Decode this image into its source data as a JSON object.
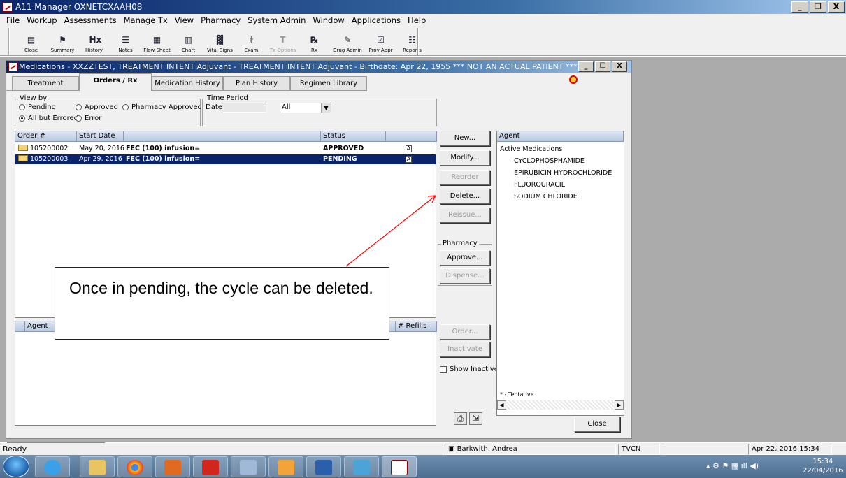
{
  "app": {
    "title": "A11 Manager OXNETCXAAH08",
    "window_buttons": [
      "_",
      "ȡ",
      "X"
    ]
  },
  "menu": [
    "File",
    "Workup",
    "Assessments",
    "Manage Tx",
    "View",
    "Pharmacy",
    "System Admin",
    "Window",
    "Applications",
    "Help"
  ],
  "toolbar": [
    {
      "label": "Close",
      "icon": "folder-icon",
      "glyph": "▤"
    },
    {
      "label": "Summary",
      "icon": "flag-icon",
      "glyph": "⚑"
    },
    {
      "label": "History",
      "icon": "hx-icon",
      "glyph": "Hx"
    },
    {
      "label": "Notes",
      "icon": "notes-icon",
      "glyph": "☰"
    },
    {
      "label": "Flow Sheet",
      "icon": "grid-icon",
      "glyph": "▦"
    },
    {
      "label": "Chart",
      "icon": "chart-icon",
      "glyph": "▥"
    },
    {
      "label": "Vital Signs",
      "icon": "vitals-icon",
      "glyph": "▓"
    },
    {
      "label": "Exam",
      "icon": "stethoscope-icon",
      "glyph": "⚕"
    },
    {
      "label": "Tx Options",
      "icon": "tx-options-icon",
      "glyph": "T",
      "disabled": true
    },
    {
      "label": "Rx",
      "icon": "rx-icon",
      "glyph": "℞"
    },
    {
      "label": "Drug Admin",
      "icon": "drug-admin-icon",
      "glyph": "✎"
    },
    {
      "label": "Prov Appr",
      "icon": "prov-appr-icon",
      "glyph": "☑"
    },
    {
      "label": "Reports",
      "icon": "reports-icon",
      "glyph": "☷"
    }
  ],
  "child": {
    "title": "Medications - XXZZTEST, TREATMENT INTENT Adjuvant  - TREATMENT INTENT Adjuvant - Birthdate: Apr 22, 1955 *** NOT AN ACTUAL PATIENT ***",
    "tabs": [
      "Treatment",
      "Orders / Rx",
      "Medication History",
      "Plan History",
      "Regimen Library"
    ],
    "active_tab": "Orders / Rx",
    "view_by": {
      "label": "View by",
      "options": [
        "Pending",
        "Approved",
        "Pharmacy Approved",
        "All but Errored",
        "Error"
      ],
      "selected": "All but Errored"
    },
    "time_period": {
      "label": "Time Period",
      "date_label": "Date",
      "date_value": "",
      "range_value": "All"
    },
    "orders": {
      "headers": [
        "Order #",
        "Start Date",
        "",
        "Status",
        ""
      ],
      "rows": [
        {
          "order": "105200002",
          "start": "May 20, 2016",
          "desc": "FEC (100) infusion=",
          "status": "APPROVED",
          "badge": "A",
          "selected": false
        },
        {
          "order": "105200003",
          "start": "Apr 29, 2016",
          "desc": "FEC (100) infusion=",
          "status": "PENDING",
          "badge": "A",
          "selected": true
        }
      ]
    },
    "buttons": {
      "new": "New...",
      "modify": "Modify...",
      "reorder": "Reorder",
      "delete": "Delete...",
      "reissue": "Reissue...",
      "pharmacy_label": "Pharmacy",
      "approve": "Approve...",
      "dispense": "Dispense...",
      "order": "Order...",
      "inactivate": "Inactivate",
      "show_inactive": "Show Inactive",
      "close": "Close"
    },
    "agent_panel": {
      "header": "Agent",
      "group": "Active Medications",
      "items": [
        "CYCLOPHOSPHAMIDE",
        "EPIRUBICIN HYDROCHLORIDE",
        "FLUOROURACIL",
        "SODIUM CHLORIDE"
      ],
      "footnote": "* - Tentative"
    },
    "lower_list": {
      "headers": [
        "Agent",
        "# Refills"
      ]
    }
  },
  "callout": {
    "text": "Once in pending, the cycle can be deleted."
  },
  "status": {
    "ready": "Ready",
    "user": "Barkwith, Andrea",
    "site": "TVCN",
    "datetime": "Apr 22, 2016 15:34"
  },
  "taskbar": {
    "time": "15:34",
    "date": "22/04/2016"
  },
  "colors": {
    "title_gradient_start": "#0a246a",
    "selection": "#0a246a",
    "callout_arrow": "#ff0000"
  }
}
